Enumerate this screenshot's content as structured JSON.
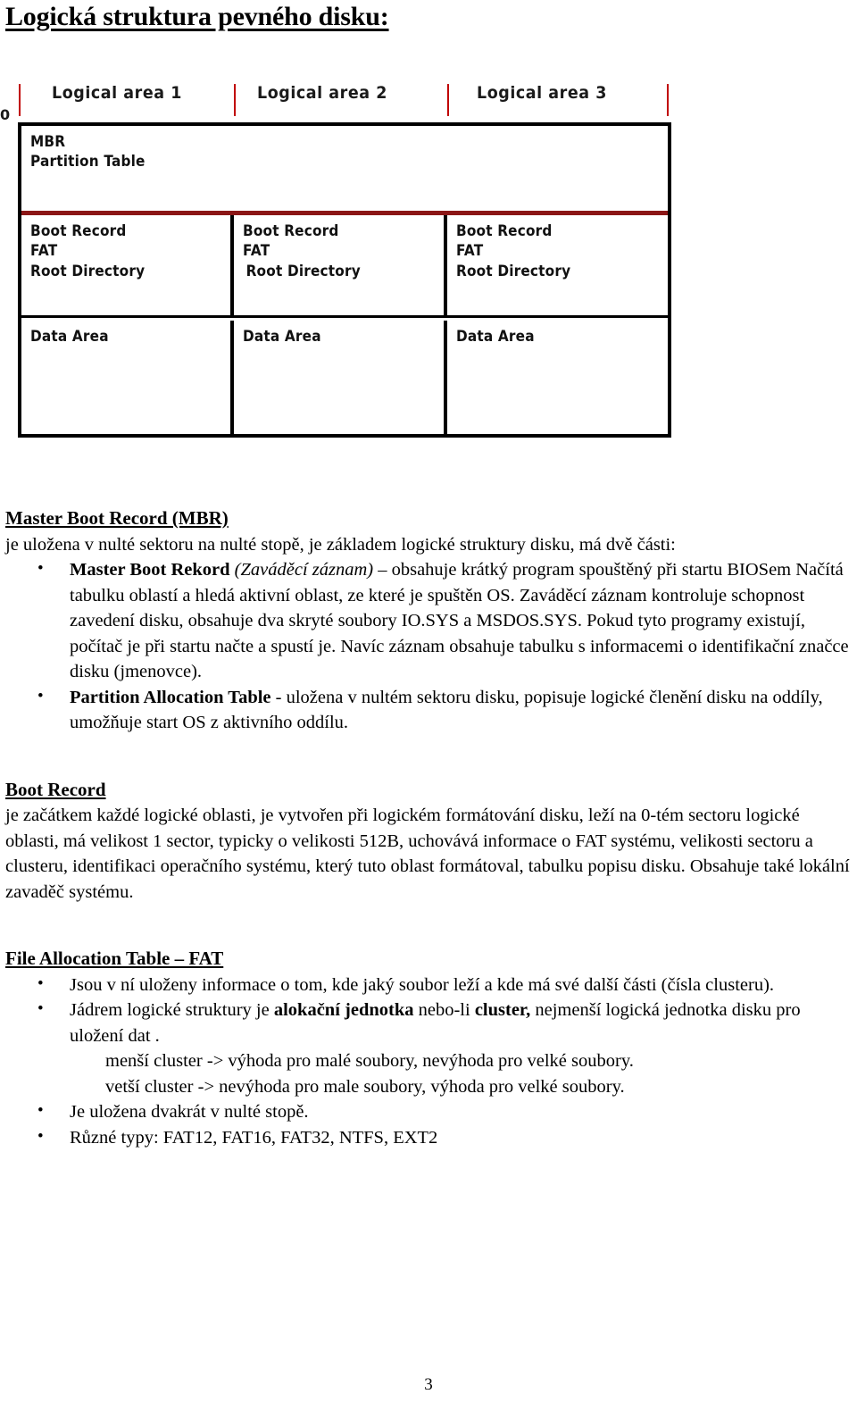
{
  "document": {
    "title": "Logická struktura pevného disku:",
    "page_number": "3"
  },
  "diagram": {
    "origin_label": "0",
    "area_labels": [
      "Logical area 1",
      "Logical area 2",
      "Logical area 3"
    ],
    "accent_color": "#c00000",
    "separator_color": "#8b1616",
    "rows": {
      "mbr": [
        "MBR",
        "Partition Table"
      ],
      "boot": {
        "col1": [
          "Boot Record",
          "FAT",
          "Root Directory"
        ],
        "col2": [
          "Boot Record",
          "FAT",
          "Root Directory"
        ],
        "col3": [
          "Boot Record",
          "FAT",
          "Root Directory"
        ]
      },
      "data": [
        "Data Area",
        "Data Area",
        "Data Area"
      ]
    }
  },
  "sections": {
    "mbr": {
      "heading": "Master Boot Record (MBR)",
      "intro": "je uložena v nulté sektoru na nulté stopě, je základem logické struktury disku, má dvě části:",
      "bullet1": {
        "bold_lead": "Master Boot Rekord",
        "italic_part": "(Zaváděcí záznam)",
        "rest": " – obsahuje krátký program spouštěný při startu BIOSem Načítá tabulku oblastí a hledá aktivní oblast, ze které je spuštěn OS. Zaváděcí záznam kontroluje schopnost zavedení disku, obsahuje dva skryté soubory IO.SYS a MSDOS.SYS. Pokud tyto programy existují, počítač je při startu načte a spustí je. Navíc záznam obsahuje tabulku s informacemi o identifikační značce disku (jmenovce)."
      },
      "bullet2": {
        "bold_lead": "Partition Allocation Table",
        "rest": " - uložena v nultém sektoru disku, popisuje logické členění disku na oddíly, umožňuje start OS z aktivního oddílu."
      }
    },
    "boot_record": {
      "heading": "Boot Record",
      "paragraph": "je začátkem každé logické oblasti, je vytvořen při logickém formátování disku, leží na 0-tém sectoru logické oblasti, má velikost 1 sector, typicky o velikosti 512B, uchovává informace o FAT systému, velikosti sectoru a clusteru, identifikaci operačního systému, který tuto oblast formátoval, tabulku popisu disku. Obsahuje také lokální zavaděč systému."
    },
    "fat": {
      "heading": "File Allocation Table – FAT",
      "bullet1": "Jsou v ní uloženy informace o tom, kde jaký soubor leží a kde má své další části (čísla clusteru).",
      "bullet2": {
        "lead": "Jádrem logické struktury je ",
        "bold1": "alokační jednotka",
        "mid": " nebo-li ",
        "bold2": "cluster,",
        "rest": " nejmenší logická jednotka disku pro uložení dat ."
      },
      "subline1": "menší cluster -> výhoda pro malé soubory, nevýhoda pro velké soubory.",
      "subline2": "vetší cluster -> nevýhoda pro male soubory, výhoda pro velké soubory.",
      "bullet3": "Je uložena dvakrát v nulté stopě.",
      "bullet4": "Různé typy: FAT12, FAT16, FAT32, NTFS, EXT2"
    }
  }
}
